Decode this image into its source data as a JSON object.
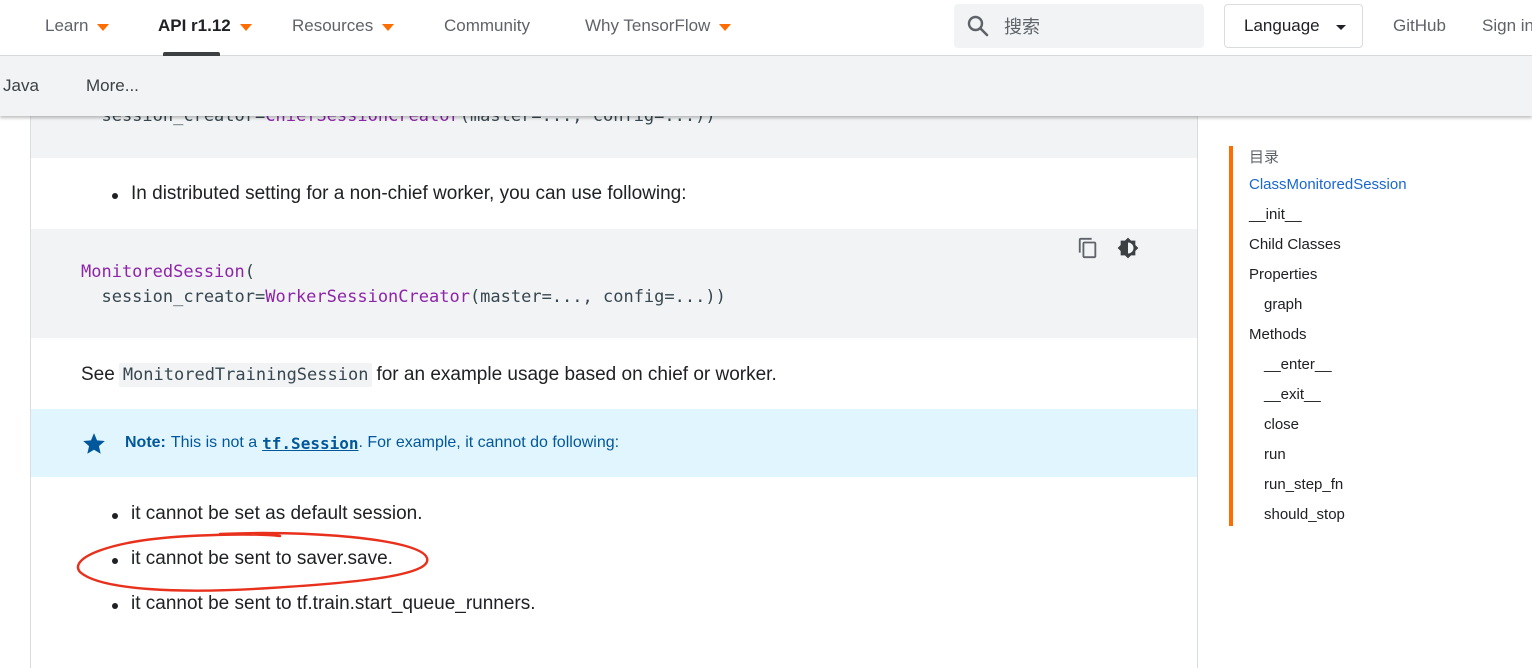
{
  "topnav": {
    "items": [
      {
        "label": "Learn",
        "dropdown": true
      },
      {
        "label": "API r1.12",
        "dropdown": true,
        "active": true
      },
      {
        "label": "Resources",
        "dropdown": true
      },
      {
        "label": "Community",
        "dropdown": false
      },
      {
        "label": "Why TensorFlow",
        "dropdown": true
      }
    ],
    "search_placeholder": "搜索",
    "language_label": "Language",
    "github_label": "GitHub",
    "signin_label": "Sign in"
  },
  "subnav": {
    "items": [
      {
        "label": "Java"
      },
      {
        "label": "More..."
      }
    ]
  },
  "content": {
    "code_top_fragment": {
      "indent": "  session_creator=",
      "fn": "ChiefSessionCreator",
      "rest": "(master=..., config=...))"
    },
    "bullet_non_chief": "In distributed setting for a non-chief worker, you can use following:",
    "code_block": {
      "line1_fn": "MonitoredSession",
      "line1_rest": "(",
      "line2_indent": "  session_creator=",
      "line2_fn": "WorkerSessionCreator",
      "line2_rest": "(master=..., config=...))"
    },
    "see_para": {
      "prefix": "See",
      "code": "MonitoredTrainingSession",
      "suffix": "for an example usage based on chief or worker."
    },
    "note": {
      "label": "Note:",
      "text_before": "This is not a",
      "code": "tf.Session",
      "text_after": ". For example, it cannot do following:"
    },
    "bullets": [
      "it cannot be set as default session.",
      "it cannot be sent to saver.save.",
      "it cannot be sent to tf.train.start_queue_runners."
    ]
  },
  "toc": {
    "title": "目录",
    "items": [
      {
        "label": "ClassMonitoredSession",
        "level": 0,
        "active": true
      },
      {
        "label": "__init__",
        "level": 0
      },
      {
        "label": "Child Classes",
        "level": 0
      },
      {
        "label": "Properties",
        "level": 0
      },
      {
        "label": "graph",
        "level": 1
      },
      {
        "label": "Methods",
        "level": 0
      },
      {
        "label": "__enter__",
        "level": 1
      },
      {
        "label": "__exit__",
        "level": 1
      },
      {
        "label": "close",
        "level": 1
      },
      {
        "label": "run",
        "level": 1
      },
      {
        "label": "run_step_fn",
        "level": 1
      },
      {
        "label": "should_stop",
        "level": 1
      }
    ]
  },
  "colors": {
    "accent_orange": "#ff6d00",
    "link_blue": "#1967d2",
    "note_bg": "#e1f5fe",
    "note_text": "#01579b",
    "code_fn": "#8e24aa",
    "annotation_red": "#e8301c"
  }
}
